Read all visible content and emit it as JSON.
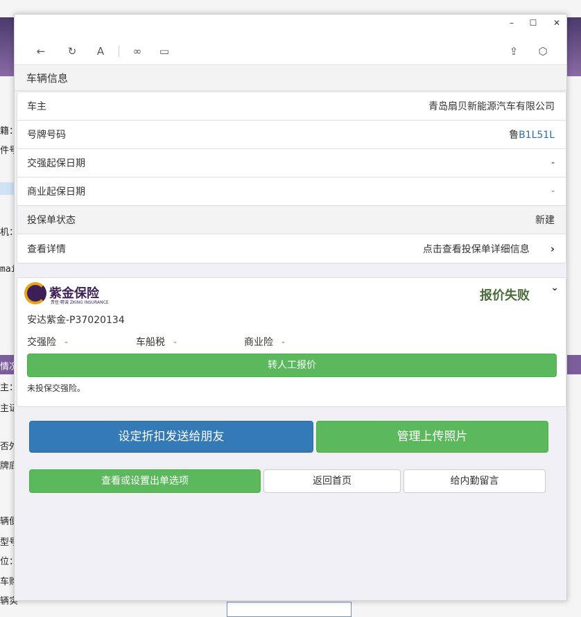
{
  "background": {
    "fragments": [
      "籍：",
      "件号",
      "机：",
      "mai",
      "情况",
      "主：",
      "主证",
      "否外",
      "牌底",
      "辆便",
      "型号",
      "位：",
      "车购",
      "辆实"
    ]
  },
  "window": {
    "controls": {
      "minimize": "–",
      "maximize": "☐",
      "close": "✕"
    }
  },
  "section_header": "车辆信息",
  "vehicle_info": [
    {
      "label": "车主",
      "value": "青岛扇贝新能源汽车有限公司"
    },
    {
      "label": "号牌号码",
      "value_prefix": "鲁",
      "value_suffix": "B1L51L"
    },
    {
      "label": "交强起保日期",
      "value": "-"
    },
    {
      "label": "商业起保日期",
      "value": "-"
    },
    {
      "label": "投保单状态",
      "value": "新建"
    },
    {
      "label": "查看详情",
      "value": "点击查看投保单详细信息"
    }
  ],
  "quote": {
    "logo_text": "紫金保险",
    "logo_sub": "责任·精诚   ZKING INSURANCE",
    "status": "报价失败",
    "company_code": "安达紫金-P37020134",
    "coverages": [
      {
        "label": "交强险",
        "value": "-"
      },
      {
        "label": "车船税",
        "value": "-"
      },
      {
        "label": "商业险",
        "value": "-"
      }
    ],
    "manual_button": "转人工报价",
    "note": "未投保交强险。"
  },
  "actions": {
    "send_discount": "设定折扣发送给朋友",
    "manage_photos": "管理上传照片",
    "order_options": "查看或设置出单选项",
    "back_home": "返回首页",
    "leave_message": "给内勤留言"
  },
  "colors": {
    "green": "#5cb85c",
    "blue": "#337ab7",
    "fail": "#4a6b3a"
  }
}
